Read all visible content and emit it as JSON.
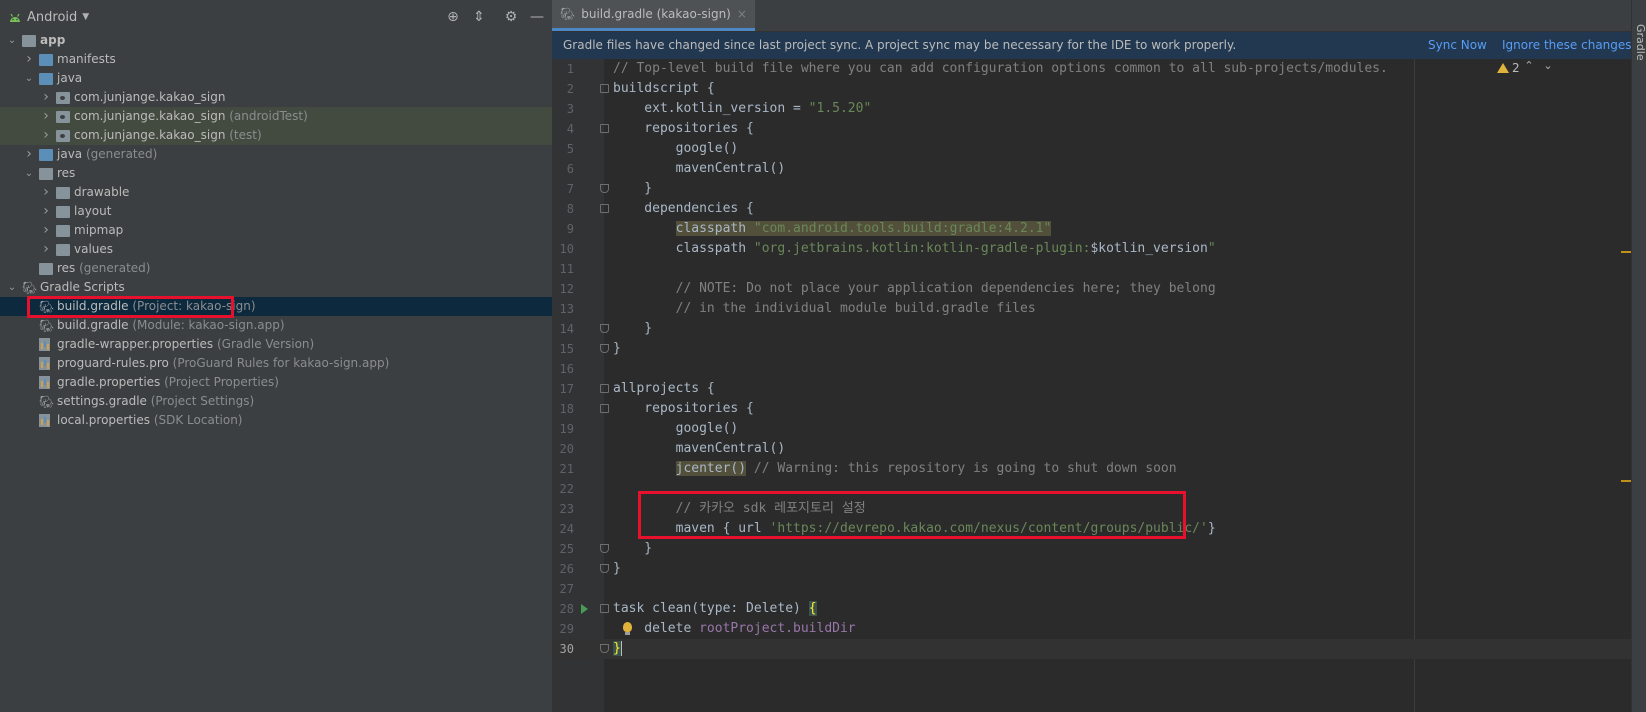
{
  "project_panel": {
    "view_selector": "Android",
    "tree": [
      {
        "label": "app",
        "suffix": "",
        "indent": 0,
        "expanded": true,
        "icon": "module-folder-icon",
        "bold": true
      },
      {
        "label": "manifests",
        "suffix": "",
        "indent": 1,
        "expanded": false,
        "icon": "folder-icon"
      },
      {
        "label": "java",
        "suffix": "",
        "indent": 1,
        "expanded": true,
        "icon": "folder-icon"
      },
      {
        "label": "com.junjange.kakao_sign",
        "suffix": "",
        "indent": 2,
        "expanded": false,
        "icon": "package-icon"
      },
      {
        "label": "com.junjange.kakao_sign",
        "suffix": "(androidTest)",
        "indent": 2,
        "expanded": false,
        "icon": "package-icon",
        "highlight": true
      },
      {
        "label": "com.junjange.kakao_sign",
        "suffix": "(test)",
        "indent": 2,
        "expanded": false,
        "icon": "package-icon",
        "highlight": true
      },
      {
        "label": "java",
        "suffix": "(generated)",
        "indent": 1,
        "expanded": false,
        "icon": "generated-folder-icon"
      },
      {
        "label": "res",
        "suffix": "",
        "indent": 1,
        "expanded": true,
        "icon": "res-folder-icon"
      },
      {
        "label": "drawable",
        "suffix": "",
        "indent": 2,
        "expanded": false,
        "icon": "folder-icon"
      },
      {
        "label": "layout",
        "suffix": "",
        "indent": 2,
        "expanded": false,
        "icon": "folder-icon"
      },
      {
        "label": "mipmap",
        "suffix": "",
        "indent": 2,
        "expanded": false,
        "icon": "folder-icon"
      },
      {
        "label": "values",
        "suffix": "",
        "indent": 2,
        "expanded": false,
        "icon": "folder-icon"
      },
      {
        "label": "res",
        "suffix": "(generated)",
        "indent": 1,
        "expanded": null,
        "icon": "res-folder-icon"
      },
      {
        "label": "Gradle Scripts",
        "suffix": "",
        "indent": 0,
        "expanded": true,
        "icon": "gradle-elephant-icon"
      },
      {
        "label": "build.gradle",
        "suffix": "(Project: kakao-sign)",
        "indent": 1,
        "expanded": null,
        "icon": "gradle-elephant-icon",
        "selected": true
      },
      {
        "label": "build.gradle",
        "suffix": "(Module: kakao-sign.app)",
        "indent": 1,
        "expanded": null,
        "icon": "gradle-elephant-icon"
      },
      {
        "label": "gradle-wrapper.properties",
        "suffix": "(Gradle Version)",
        "indent": 1,
        "expanded": null,
        "icon": "properties-file-icon"
      },
      {
        "label": "proguard-rules.pro",
        "suffix": "(ProGuard Rules for kakao-sign.app)",
        "indent": 1,
        "expanded": null,
        "icon": "properties-file-icon"
      },
      {
        "label": "gradle.properties",
        "suffix": "(Project Properties)",
        "indent": 1,
        "expanded": null,
        "icon": "properties-file-icon"
      },
      {
        "label": "settings.gradle",
        "suffix": "(Project Settings)",
        "indent": 1,
        "expanded": null,
        "icon": "gradle-elephant-icon"
      },
      {
        "label": "local.properties",
        "suffix": "(SDK Location)",
        "indent": 1,
        "expanded": null,
        "icon": "properties-file-icon"
      }
    ]
  },
  "editor": {
    "tab": {
      "label": "build.gradle (kakao-sign)",
      "close": "×"
    },
    "notification": {
      "text": "Gradle files have changed since last project sync. A project sync may be necessary for the IDE to work properly.",
      "sync_now": "Sync Now",
      "ignore": "Ignore these changes"
    },
    "warnings_count": "2",
    "lines": [
      [
        [
          "c",
          "// Top-level build file where you can add configuration options common to all sub-projects/modules."
        ]
      ],
      [
        [
          "t",
          "buildscript {"
        ]
      ],
      [
        [
          "t",
          "    ext.kotlin_version = "
        ],
        [
          "s",
          "\"1.5.20\""
        ]
      ],
      [
        [
          "t",
          "    repositories {"
        ]
      ],
      [
        [
          "t",
          "        google()"
        ]
      ],
      [
        [
          "t",
          "        mavenCentral()"
        ]
      ],
      [
        [
          "t",
          "    }"
        ]
      ],
      [
        [
          "t",
          "    dependencies {"
        ]
      ],
      [
        [
          "t",
          "        "
        ],
        [
          "w",
          "classpath "
        ],
        [
          "ws",
          "\"com.android.tools.build:gradle:4.2.1\""
        ]
      ],
      [
        [
          "t",
          "        classpath "
        ],
        [
          "s",
          "\"org.jetbrains.kotlin:kotlin-gradle-plugin:"
        ],
        [
          "t",
          "$kotlin_version"
        ],
        [
          "s",
          "\""
        ]
      ],
      [
        [
          "t",
          ""
        ]
      ],
      [
        [
          "t",
          "        "
        ],
        [
          "c",
          "// NOTE: Do not place your application dependencies here; they belong"
        ]
      ],
      [
        [
          "t",
          "        "
        ],
        [
          "c",
          "// in the individual module build.gradle files"
        ]
      ],
      [
        [
          "t",
          "    }"
        ]
      ],
      [
        [
          "t",
          "}"
        ]
      ],
      [
        [
          "t",
          ""
        ]
      ],
      [
        [
          "t",
          "allprojects {"
        ]
      ],
      [
        [
          "t",
          "    repositories {"
        ]
      ],
      [
        [
          "t",
          "        google()"
        ]
      ],
      [
        [
          "t",
          "        mavenCentral()"
        ]
      ],
      [
        [
          "t",
          "        "
        ],
        [
          "w",
          "jcenter()"
        ],
        [
          "c",
          " // Warning: this repository is going to shut down soon"
        ]
      ],
      [
        [
          "t",
          ""
        ]
      ],
      [
        [
          "t",
          "        "
        ],
        [
          "c",
          "// 카카오 sdk 레포지토리 설정"
        ]
      ],
      [
        [
          "t",
          "        maven { url "
        ],
        [
          "s",
          "'https://devrepo.kakao.com/nexus/content/groups/public/'"
        ],
        [
          "t",
          "}"
        ]
      ],
      [
        [
          "t",
          "    }"
        ]
      ],
      [
        [
          "t",
          "}"
        ]
      ],
      [
        [
          "t",
          ""
        ]
      ],
      [
        [
          "t",
          "task clean("
        ],
        [
          "t",
          "type"
        ],
        [
          "t",
          ": Delete) "
        ],
        [
          "b",
          "{"
        ]
      ],
      [
        [
          "t",
          "    delete "
        ],
        [
          "f",
          "rootProject.buildDir"
        ]
      ],
      [
        [
          "b",
          "}"
        ]
      ]
    ]
  },
  "right_strip": {
    "label": "Gradle"
  },
  "colors": {
    "accent": "#4a88c7",
    "highlight_box": "#e8112d",
    "link": "#589df6",
    "string": "#6a8759",
    "comment": "#808080"
  }
}
